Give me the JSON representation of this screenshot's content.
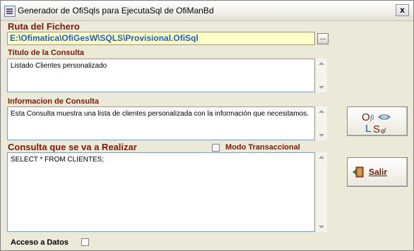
{
  "window": {
    "title": "Generador de OfiSqls para EjecutaSql de OfiManBd",
    "close_label": "x"
  },
  "ruta": {
    "label": "Ruta del Fichero",
    "value": "E:\\Ofimatica\\OfiGesW\\SQLS\\Provisional.OfiSql",
    "browse_label": "..."
  },
  "titulo": {
    "label": "Titulo de la Consulta",
    "value": "Listado Clientes personalizado"
  },
  "informacion": {
    "label": "Informacion de Consulta",
    "value": "Esta Consulta muestra una lista de clientes personalizada con la información que necesitamos."
  },
  "consulta": {
    "label": "Consulta que se va a Realizar",
    "value": "SELECT * FROM CLIENTES;"
  },
  "modo_transaccional": {
    "label": "Modo Transaccional",
    "checked": false
  },
  "acceso_datos": {
    "label": "Acceso a Datos",
    "checked": false
  },
  "buttons": {
    "generate_icon": "ofi-lsql-logo-icon",
    "salir_label": "Salir",
    "salir_icon": "exit-door-icon"
  }
}
